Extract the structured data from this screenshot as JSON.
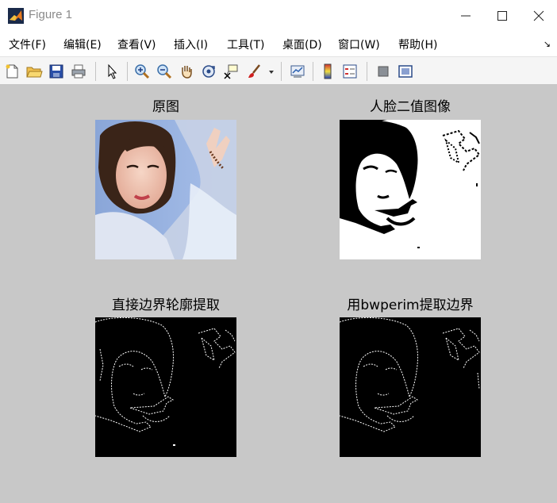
{
  "window": {
    "title": "Figure 1",
    "app_icon": "matlab-logo-icon",
    "controls": [
      "minimize-icon",
      "maximize-icon",
      "close-icon"
    ]
  },
  "menubar": {
    "items": [
      {
        "label": "文件(F)"
      },
      {
        "label": "编辑(E)"
      },
      {
        "label": "查看(V)"
      },
      {
        "label": "插入(I)"
      },
      {
        "label": "工具(T)"
      },
      {
        "label": "桌面(D)"
      },
      {
        "label": "窗口(W)"
      },
      {
        "label": "帮助(H)"
      }
    ],
    "overflow_icon": "dock-arrow-icon"
  },
  "toolbar": {
    "buttons": [
      "new-figure-icon",
      "open-file-icon",
      "save-icon",
      "print-icon",
      "pointer-icon",
      "zoom-in-icon",
      "zoom-out-icon",
      "pan-hand-icon",
      "rotate-3d-icon",
      "data-cursor-icon",
      "brush-icon",
      "brush-dropdown-icon",
      "link-plot-icon",
      "colorbar-icon",
      "legend-icon",
      "hide-plot-tools-icon",
      "show-plot-tools-icon"
    ]
  },
  "figure": {
    "background": "#c8c8c8",
    "subplots": [
      {
        "title": "原图",
        "image": "color-portrait"
      },
      {
        "title": "人脸二值图像",
        "image": "binary-face"
      },
      {
        "title": "直接边界轮廓提取",
        "image": "edge-outline"
      },
      {
        "title": "用bwperim提取边界",
        "image": "bwperim-outline"
      }
    ]
  }
}
